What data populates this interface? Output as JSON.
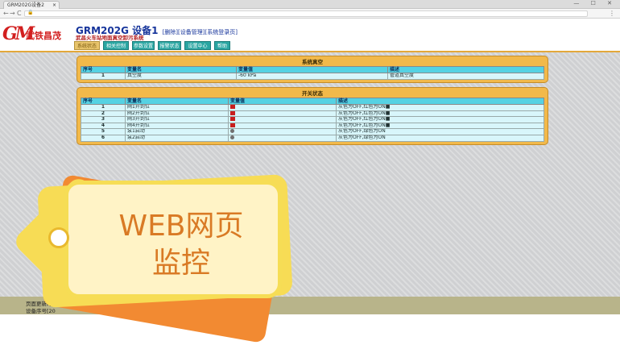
{
  "browser": {
    "tab_title": "GRM202G设备2",
    "tab_close": "×",
    "window_controls": "— ☐ ✕",
    "back": "←",
    "forward": "→",
    "reload": "C",
    "lock": "🔒",
    "menu": "⋮"
  },
  "header": {
    "logo_mark": "GM",
    "logo_text": "武铁昌茂",
    "title": "GRM202G 设备1",
    "links": "[删除][设备管理][系统登录页]",
    "subtitle": "武昌火车站地面真空卸污系统",
    "nav_tabs": [
      "系统状态",
      "相关控制",
      "参数设置",
      "报警状态",
      "设置中心",
      "帮助"
    ]
  },
  "vacuum_panel": {
    "title": "系统真空",
    "columns": [
      "序号",
      "变量名",
      "变量值",
      "描述"
    ],
    "rows": [
      {
        "no": "1",
        "name": "真空度",
        "value": "-60 kPa",
        "desc": "管道真空度"
      }
    ]
  },
  "switch_panel": {
    "title": "开关状态",
    "columns": [
      "序号",
      "变量名",
      "变量值",
      "描述"
    ],
    "rows": [
      {
        "no": "1",
        "name": "阀1开到位",
        "indicator": "square",
        "desc": "灰色为OFF,红色为ON■"
      },
      {
        "no": "2",
        "name": "阀2开到位",
        "indicator": "square",
        "desc": "灰色为OFF,红色为ON■"
      },
      {
        "no": "3",
        "name": "阀3开到位",
        "indicator": "square",
        "desc": "灰色为OFF,红色为ON■"
      },
      {
        "no": "4",
        "name": "阀4开到位",
        "indicator": "square",
        "desc": "灰色为OFF,红色为ON■"
      },
      {
        "no": "5",
        "name": "泵1启动",
        "indicator": "dot",
        "desc": "灰色为OFF,绿色为ON"
      },
      {
        "no": "6",
        "name": "泵2启动",
        "indicator": "dot",
        "desc": "灰色为OFF,绿色为ON"
      }
    ]
  },
  "footer": {
    "line1": "页面更新时",
    "line2": "设备序号[20"
  },
  "overlay": {
    "line1": "WEB网页",
    "line2": "监控"
  },
  "colors": {
    "panel": "#f2b94a",
    "table_header": "#55d2e3",
    "nav_tab": "#2aa6a2",
    "indicator_on": "#c81e1e",
    "indicator_off": "#707070",
    "overlay_text": "#d97a25"
  }
}
